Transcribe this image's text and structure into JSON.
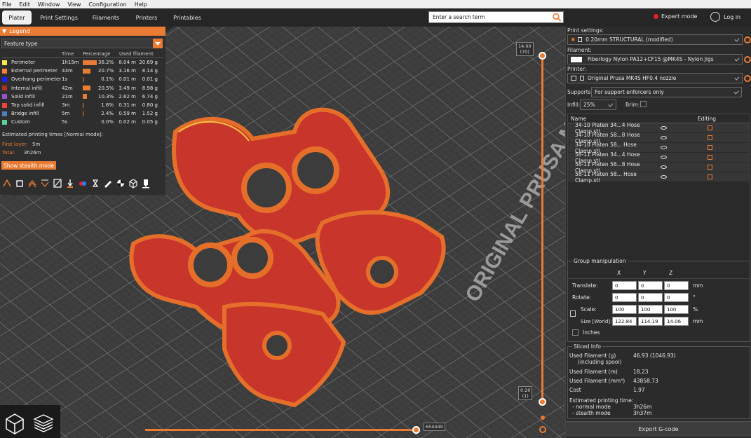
{
  "menu": [
    "File",
    "Edit",
    "Window",
    "View",
    "Configuration",
    "Help"
  ],
  "tabs": [
    {
      "label": "Plater",
      "active": true
    },
    {
      "label": "Print Settings",
      "active": false
    },
    {
      "label": "Filaments",
      "active": false
    },
    {
      "label": "Printers",
      "active": false
    },
    {
      "label": "Printables",
      "active": false
    }
  ],
  "search": {
    "placeholder": "Enter a search term"
  },
  "header": {
    "mode": "Expert mode",
    "login": "Log in"
  },
  "legend": {
    "title": "Legend",
    "type_select": "Feature type",
    "columns": {
      "time": "Time",
      "percentage": "Percentage",
      "used": "Used filament"
    },
    "rows": [
      {
        "name": "Perimeter",
        "color": "#ffe64d",
        "time": "1h15m",
        "pct": 36.2,
        "pct_label": "36.2%",
        "m": "8.04 m",
        "g": "20.69 g"
      },
      {
        "name": "External perimeter",
        "color": "#ff7d38",
        "time": "43m",
        "pct": 20.7,
        "pct_label": "20.7%",
        "m": "3.16 m",
        "g": "8.14 g"
      },
      {
        "name": "Overhang perimeter",
        "color": "#1f1fff",
        "time": "1s",
        "pct": 0.1,
        "pct_label": "0.1%",
        "m": "0.01 m",
        "g": "0.01 g"
      },
      {
        "name": "Internal infill",
        "color": "#b03029",
        "time": "42m",
        "pct": 20.5,
        "pct_label": "20.5%",
        "m": "3.49 m",
        "g": "8.98 g"
      },
      {
        "name": "Solid infill",
        "color": "#9654cc",
        "time": "21m",
        "pct": 10.3,
        "pct_label": "10.3%",
        "m": "2.62 m",
        "g": "6.74 g"
      },
      {
        "name": "Top solid infill",
        "color": "#f04040",
        "time": "3m",
        "pct": 1.6,
        "pct_label": "1.6%",
        "m": "0.31 m",
        "g": "0.80 g"
      },
      {
        "name": "Bridge infill",
        "color": "#4d80ba",
        "time": "5m",
        "pct": 2.4,
        "pct_label": "2.4%",
        "m": "0.59 m",
        "g": "1.52 g"
      },
      {
        "name": "Custom",
        "color": "#5ed194",
        "time": "5s",
        "pct": 0.0,
        "pct_label": "0.0%",
        "m": "0.02 m",
        "g": "0.05 g"
      }
    ],
    "estimated_label": "Estimated printing times [Normal mode]:",
    "first_layer_label": "First layer:",
    "first_layer_value": "5m",
    "total_label": "Total:",
    "total_value": "3h26m",
    "stealth_button": "Show stealth mode"
  },
  "viewport": {
    "top_slider": {
      "value": "14.00",
      "layer": "(70)"
    },
    "bottom_slider": {
      "value": "0.20",
      "layer": "(1)"
    },
    "horizontal_value": "654449"
  },
  "sidebar": {
    "print_settings_label": "Print settings:",
    "print_settings_value": "0.20mm STRUCTURAL (modified)",
    "filament_label": "Filament:",
    "filament_value": "Fiberlogy Nylon PA12+CF15 @MK4S - Nylon Jigs",
    "printer_label": "Printer:",
    "printer_value": "Original Prusa MK4S HF0.4 nozzle",
    "supports_label": "Supports:",
    "supports_value": "For support enforcers only",
    "infill_label": "Infill:",
    "infill_value": "25%",
    "brim_label": "Brim:"
  },
  "objects": {
    "col_name": "Name",
    "col_editing": "Editing",
    "rows": [
      "34-10 Platen 34...4 Hose Clamp.stl",
      "34-10 Platen 58...8 Hose Clamp.stl",
      "34-10 Platen 58... Hose Clamp.stl",
      "58-11 Platen 34...4 Hose Clamp.stl",
      "58-11 Platen 58...8 Hose Clamp.stl",
      "58-11 Platen 58... Hose Clamp.stl"
    ]
  },
  "group": {
    "title": "Group manipulation",
    "axes": [
      "X",
      "Y",
      "Z"
    ],
    "translate_label": "Translate:",
    "translate": [
      "0",
      "0",
      "0"
    ],
    "translate_unit": "mm",
    "rotate_label": "Rotate:",
    "rotate": [
      "0",
      "0",
      "0"
    ],
    "rotate_unit": "°",
    "scale_label": "Scale:",
    "scale": [
      "100",
      "100",
      "100"
    ],
    "scale_unit": "%",
    "size_label": "Size [World]:",
    "size": [
      "122.84",
      "114.19",
      "14.06"
    ],
    "size_unit": "mm",
    "inches_label": "Inches"
  },
  "sliced": {
    "title": "Sliced Info",
    "used_g_label": "Used Filament (g)",
    "used_g_sub": "(including spool)",
    "used_g": "46.93 (1046.93)",
    "used_m_label": "Used Filament (m)",
    "used_m": "18.23",
    "used_mm3_label": "Used Filament (mm³)",
    "used_mm3": "43858.73",
    "cost_label": "Cost",
    "cost": "1.97",
    "est_label": "Estimated printing time:",
    "normal_label": "- normal mode",
    "normal": "3h26m",
    "stealth_label": "- stealth mode",
    "stealth": "3h37m"
  },
  "export_button": "Export G-code",
  "bed_text": "ORIGINAL PRUSA MK",
  "colors": {
    "accent": "#ea7b33",
    "part_red": "#c8362b"
  }
}
